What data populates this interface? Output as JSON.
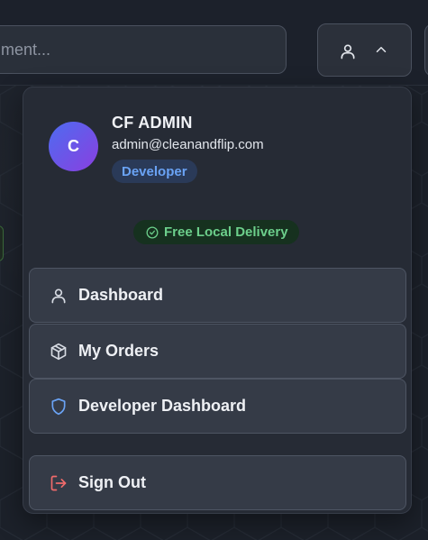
{
  "header": {
    "search_placeholder": "ment...",
    "user_icon": "user-icon",
    "chevron_icon": "chevron-up-icon"
  },
  "profile": {
    "avatar_initial": "C",
    "name": "CF ADMIN",
    "email": "admin@cleanandflip.com",
    "role": "Developer"
  },
  "delivery": {
    "label": "Free Local Delivery",
    "icon": "check-circle-icon"
  },
  "menu_items": [
    {
      "label": "Dashboard",
      "icon": "user-icon"
    },
    {
      "label": "My Orders",
      "icon": "package-icon"
    },
    {
      "label": "Developer Dashboard",
      "icon": "shield-icon"
    },
    {
      "label": "Sign Out",
      "icon": "log-out-icon"
    }
  ],
  "colors": {
    "background": "#1c212a",
    "menu_bg": "#262b35",
    "item_bg": "#353b47",
    "accent_blue": "#6aa3f5",
    "accent_green": "#6ccf8b",
    "danger": "#f06b6b"
  }
}
